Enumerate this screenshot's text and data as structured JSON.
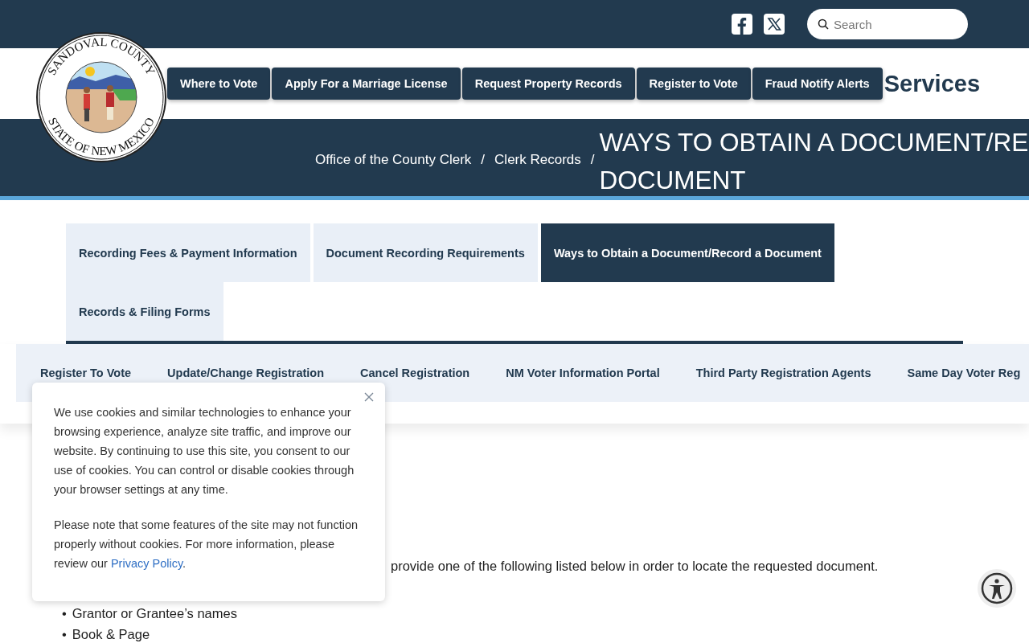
{
  "header": {
    "social": [
      {
        "kind": "facebook"
      },
      {
        "kind": "x"
      }
    ],
    "search": {
      "placeholder": "Search"
    }
  },
  "logo": {
    "top_text": "SANDOVAL COUNTY",
    "bottom_text": "STATE OF NEW MEXICO"
  },
  "quick_links": [
    "Where to Vote",
    "Apply For a Marriage License",
    "Request Property Records",
    "Register to Vote",
    "Fraud Notify Alerts"
  ],
  "section_heading": "Services",
  "breadcrumb": [
    {
      "label": "Office of the County Clerk",
      "separator": "/"
    },
    {
      "label": "Clerk Records",
      "separator": "/"
    }
  ],
  "page_title_lines": [
    "WAYS TO OBTAIN A DOCUMENT/RE",
    "DOCUMENT"
  ],
  "tabs": [
    {
      "label": "Recording Fees & Payment Information",
      "selected": false
    },
    {
      "label": "Document Recording Requirements",
      "selected": false
    },
    {
      "label": "Ways to Obtain a Document/Record a Document",
      "selected": true
    },
    {
      "label": "Records & Filing Forms",
      "selected": false
    }
  ],
  "subnav": [
    "Register To Vote",
    "Update/Change Registration",
    "Cancel Registration",
    "NM Voter Information Portal",
    "Third Party Registration Agents",
    "Same Day Voter Reg"
  ],
  "content": {
    "paragraph": "provide one of the following listed below in order to locate the requested document.",
    "list": [
      {
        "marker": "•",
        "text": "Grantor or Grantee’s names"
      },
      {
        "marker": "•",
        "text": "Book & Page"
      }
    ]
  },
  "cookie_notice": {
    "paragraph": "We use cookies and similar technologies to enhance your browsing experience, analyze site traffic, and improve our website. By continuing to use this site, you consent to our use of cookies. You can control or disable cookies through your browser settings at any time.",
    "note": "Please note that some features of the site may not function properly without cookies. For more information, please review our ",
    "link": "Privacy Policy",
    "note_end": "."
  }
}
